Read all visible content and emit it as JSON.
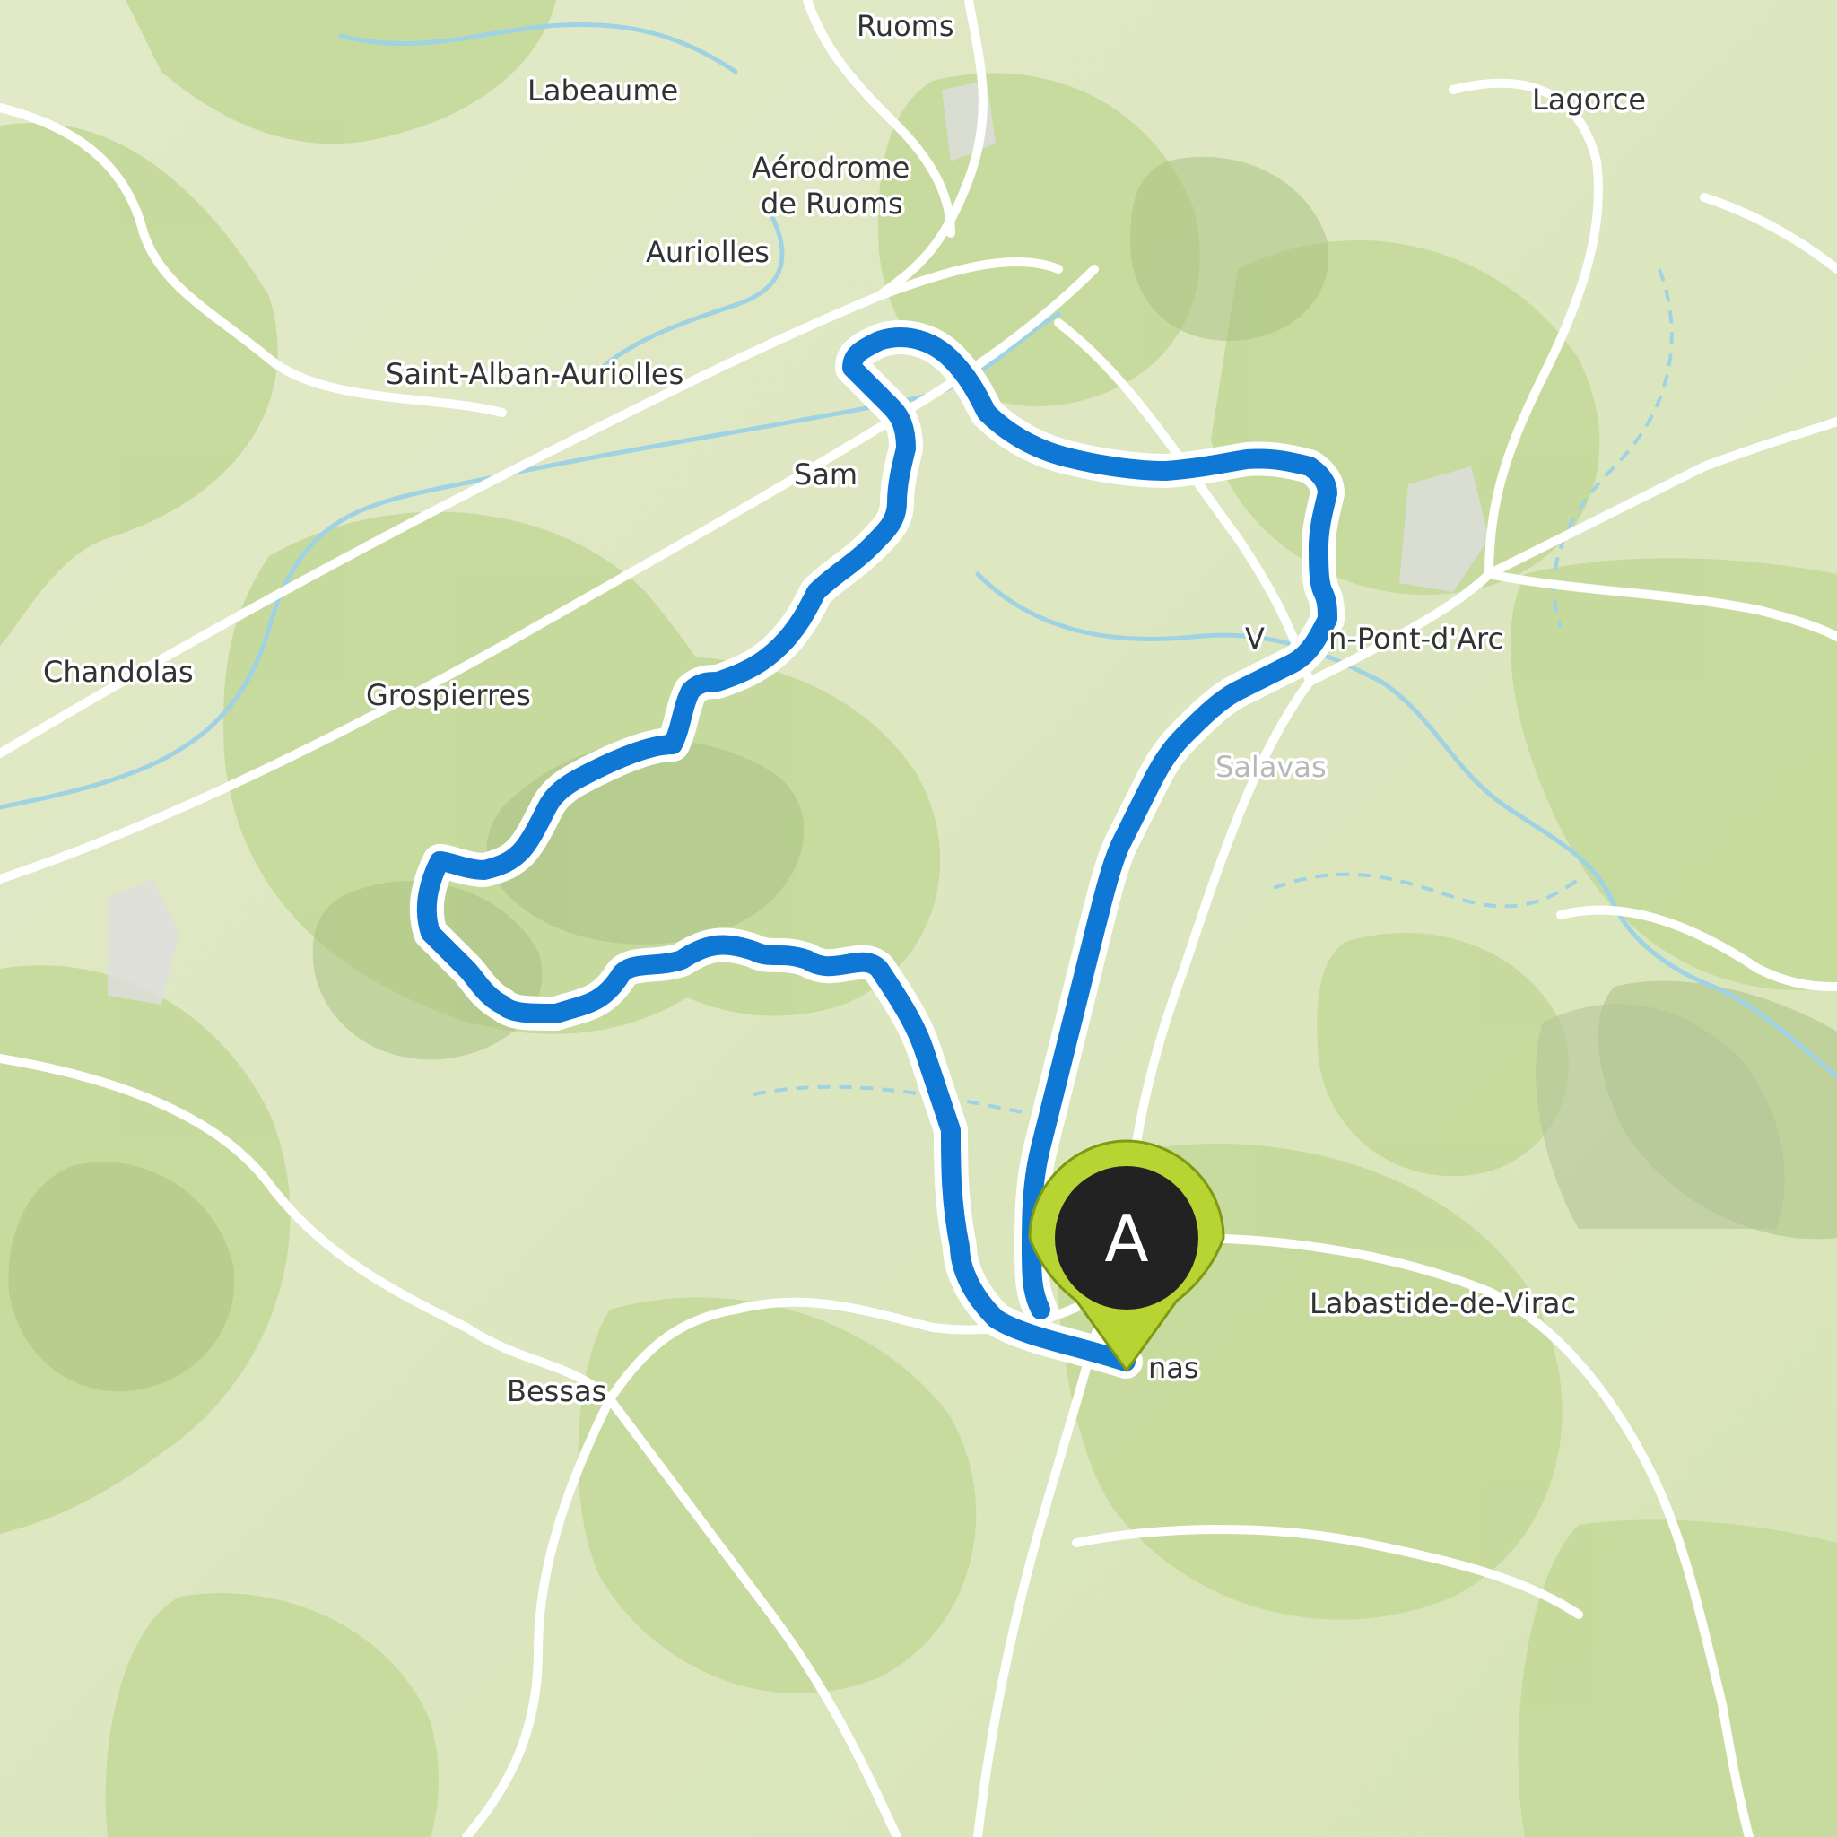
{
  "map": {
    "place_labels": [
      {
        "id": "ruoms",
        "text": "Ruoms"
      },
      {
        "id": "labeaume",
        "text": "Labeaume"
      },
      {
        "id": "lagorce",
        "text": "Lagorce"
      },
      {
        "id": "aerodrome-1",
        "text": "Aérodrome"
      },
      {
        "id": "aerodrome-2",
        "text": "de Ruoms"
      },
      {
        "id": "auriolles",
        "text": "Auriolles"
      },
      {
        "id": "saint-alban",
        "text": "Saint-Alban-Auriolles"
      },
      {
        "id": "sampzon",
        "text": "Sam"
      },
      {
        "id": "vallon",
        "text": "V       n-Pont-d'Arc"
      },
      {
        "id": "salavas",
        "text": "Salavas"
      },
      {
        "id": "chandolas",
        "text": "Chandolas"
      },
      {
        "id": "grospierres",
        "text": "Grospierres"
      },
      {
        "id": "labastide",
        "text": "Labastide-de-Virac"
      },
      {
        "id": "orgnac",
        "text": "nas"
      },
      {
        "id": "bessas",
        "text": "Bessas"
      }
    ],
    "marker": {
      "letter": "A",
      "color": "#b7d432"
    },
    "route": {
      "color": "#0f78d4",
      "type": "loop"
    },
    "colors": {
      "forest": "#c9dca0",
      "open_land": "#eef0da",
      "river": "#9fd2e3",
      "road": "#ffffff"
    }
  }
}
